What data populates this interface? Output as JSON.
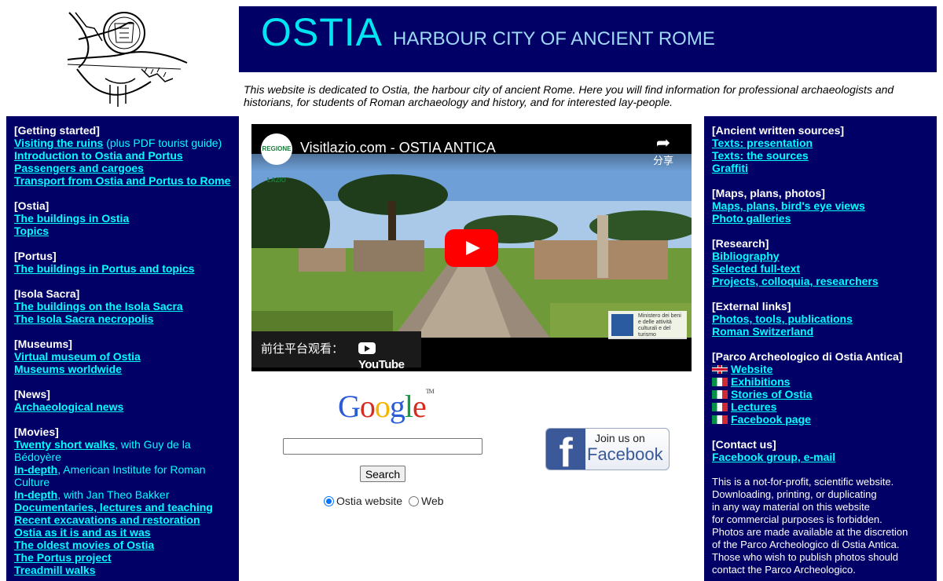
{
  "header": {
    "title": "OSTIA",
    "subtitle": "HARBOUR CITY OF ANCIENT ROME",
    "intro": "This website is dedicated to Ostia, the harbour city of ancient Rome. Here you will find information for professional archaeologists and historians, for students of Roman archaeology and history, and for interested lay-people."
  },
  "left_sidebar": {
    "sections": [
      {
        "title": "[Getting started]",
        "links": [
          {
            "label": "Visiting the ruins",
            "rest": " (plus PDF tourist guide)"
          },
          {
            "label": "Introduction to Ostia and Portus",
            "rest": ""
          },
          {
            "label": "Passengers and cargoes",
            "rest": ""
          },
          {
            "label": "Transport from Ostia and Portus to Rome",
            "rest": ""
          }
        ]
      },
      {
        "title": "[Ostia]",
        "links": [
          {
            "label": "The buildings in Ostia",
            "rest": ""
          },
          {
            "label": "Topics",
            "rest": ""
          }
        ]
      },
      {
        "title": "[Portus]",
        "links": [
          {
            "label": "The buildings in Portus and topics",
            "rest": ""
          }
        ]
      },
      {
        "title": "[Isola Sacra]",
        "links": [
          {
            "label": "The buildings on the Isola Sacra",
            "rest": ""
          },
          {
            "label": "The Isola Sacra necropolis",
            "rest": ""
          }
        ]
      },
      {
        "title": "[Museums]",
        "links": [
          {
            "label": "Virtual museum of Ostia",
            "rest": ""
          },
          {
            "label": "Museums worldwide",
            "rest": ""
          }
        ]
      },
      {
        "title": "[News]",
        "links": [
          {
            "label": "Archaeological news",
            "rest": ""
          }
        ]
      },
      {
        "title": "[Movies]",
        "links": [
          {
            "label": "Twenty short walks",
            "rest": ", with Guy de la Bédoyère"
          },
          {
            "label": "In-depth",
            "rest": ", American Institute for Roman Culture"
          },
          {
            "label": "In-depth",
            "rest": ", with Jan Theo Bakker"
          },
          {
            "label": "Documentaries, lectures and teaching",
            "rest": ""
          },
          {
            "label": "Recent excavations and restoration",
            "rest": ""
          },
          {
            "label": "Ostia as it is and as it was",
            "rest": ""
          },
          {
            "label": "The oldest movies of Ostia",
            "rest": ""
          },
          {
            "label": "The Portus project",
            "rest": ""
          },
          {
            "label": "Treadmill walks",
            "rest": ""
          }
        ]
      }
    ]
  },
  "right_sidebar": {
    "written": {
      "title": "[Ancient written sources]",
      "links": [
        "Texts: presentation",
        "Texts: the sources",
        "Graffiti"
      ]
    },
    "maps": {
      "title": "[Maps, plans, photos]",
      "links": [
        "Maps, plans, bird's eye views",
        "Photo galleries"
      ]
    },
    "research": {
      "title": "[Research]",
      "links": [
        "Bibliography",
        "Selected full-text",
        "Projects, colloquia, researchers"
      ]
    },
    "external": {
      "title": "[External links]",
      "links": [
        "Photos, tools, publications",
        "Roman Switzerland"
      ]
    },
    "parco": {
      "title": "[Parco Archeologico di Ostia Antica]",
      "links": [
        "Website",
        "Exhibitions",
        "Stories of Ostia",
        "Lectures",
        "Facebook page"
      ]
    },
    "contact": {
      "title": "[Contact us]",
      "links": [
        "Facebook group, e-mail"
      ]
    },
    "notice": [
      "This is a not-for-profit, scientific website.",
      "Downloading, printing, or duplicating",
      "in any way material on this website",
      "for commercial purposes is forbidden.",
      "Photos are made available at the discretion",
      "of the Parco Archeologico di Ostia Antica.",
      "Those who wish to publish photos should",
      "contact the Parco Archeologico."
    ]
  },
  "video": {
    "title": "Visitlazio.com - OSTIA ANTICA",
    "channel": "REGIONE LAZIO",
    "share": "分享",
    "watch_on": "前往平台观看：",
    "youtube": "YouTube",
    "badge": "Ministero dei beni e delle attività culturali e del turismo"
  },
  "search": {
    "google": [
      "G",
      "o",
      "o",
      "g",
      "l",
      "e"
    ],
    "google_colors": [
      "#2a5bd7",
      "#d62d20",
      "#f4b400",
      "#2a5bd7",
      "#169b45",
      "#d62d20"
    ],
    "tm": "TM",
    "input_value": "",
    "button": "Search",
    "option_site": "Ostia website",
    "option_web": "Web"
  },
  "facebook": {
    "join": "Join us on",
    "brand": "Facebook",
    "f": "f"
  },
  "colors": {
    "navy": "#000066",
    "cyan": "#00ffff"
  }
}
